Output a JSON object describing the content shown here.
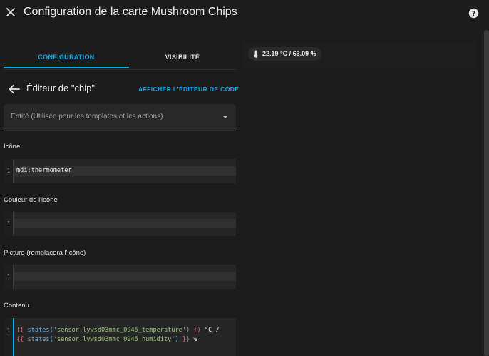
{
  "header": {
    "title": "Configuration de la carte Mushroom Chips"
  },
  "tabs": {
    "configuration": "CONFIGURATION",
    "visibilite": "VISIBILITÉ"
  },
  "editor": {
    "title": "Éditeur de \"chip\"",
    "show_code_editor": "AFFICHER L'ÉDITEUR DE CODE"
  },
  "entity": {
    "label": "Entité (Utilisée pour les templates et les actions)"
  },
  "fields": {
    "icon": {
      "label": "Icône",
      "line_number": "1",
      "value": "mdi:thermometer"
    },
    "icon_color": {
      "label": "Couleur de l'icône",
      "line_number": "1",
      "value": ""
    },
    "picture": {
      "label": "Picture (remplacera l'icône)",
      "line_number": "1",
      "value": ""
    },
    "content": {
      "label": "Contenu",
      "line_number": "1",
      "line1": {
        "open": "{{",
        "func": "states(",
        "str": "'sensor.lywsd03mmc_0945_temperature'",
        "close_paren": ")",
        "close": "}}",
        "tail": " °C /"
      },
      "line2": {
        "open": "{{",
        "func": "states(",
        "str": "'sensor.lywsd03mmc_0945_humidity'",
        "close_paren": ")",
        "close": "}}",
        "tail": " %"
      }
    }
  },
  "preview": {
    "chip_text": "22.19 °C / 63.09 %",
    "chip_icon": "thermometer-icon"
  },
  "colors": {
    "accent": "#03a9f4",
    "background": "#1c1c1c",
    "code_brace": "#e06c75",
    "code_string": "#98c379",
    "code_function": "#61afef"
  }
}
